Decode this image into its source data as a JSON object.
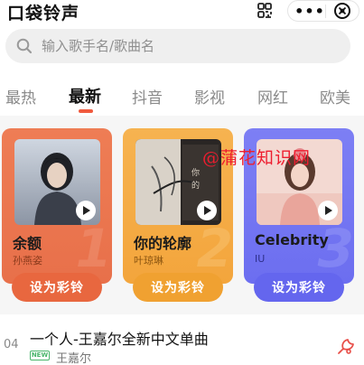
{
  "header": {
    "title": "口袋铃声",
    "scan_icon": "scan-icon",
    "more_label": "•••",
    "close_icon": "close-circle-icon"
  },
  "search": {
    "placeholder": "输入歌手名/歌曲名",
    "value": ""
  },
  "tabs": [
    {
      "label": "最热",
      "active": false
    },
    {
      "label": "最新",
      "active": true
    },
    {
      "label": "抖音",
      "active": false
    },
    {
      "label": "影视",
      "active": false
    },
    {
      "label": "网红",
      "active": false
    },
    {
      "label": "欧美",
      "active": false
    }
  ],
  "cards": [
    {
      "title": "余额",
      "artist": "孙燕姿",
      "rank": "1",
      "button": "设为彩铃",
      "color": "#e8704a"
    },
    {
      "title": "你的轮廓",
      "artist": "叶琼琳",
      "rank": "2",
      "button": "设为彩铃",
      "color": "#f3a53c"
    },
    {
      "title": "Celebrity",
      "artist": "IU",
      "rank": "3",
      "button": "设为彩铃",
      "color": "#6c6ef0"
    }
  ],
  "watermark": "@蒲花知识网",
  "list": [
    {
      "rank": "04",
      "title": "一个人-王嘉尔全新中文单曲",
      "badge": "NEW",
      "artist": "王嘉尔"
    }
  ],
  "colors": {
    "accent": "#f05a3e",
    "new_badge": "#49b56b"
  }
}
